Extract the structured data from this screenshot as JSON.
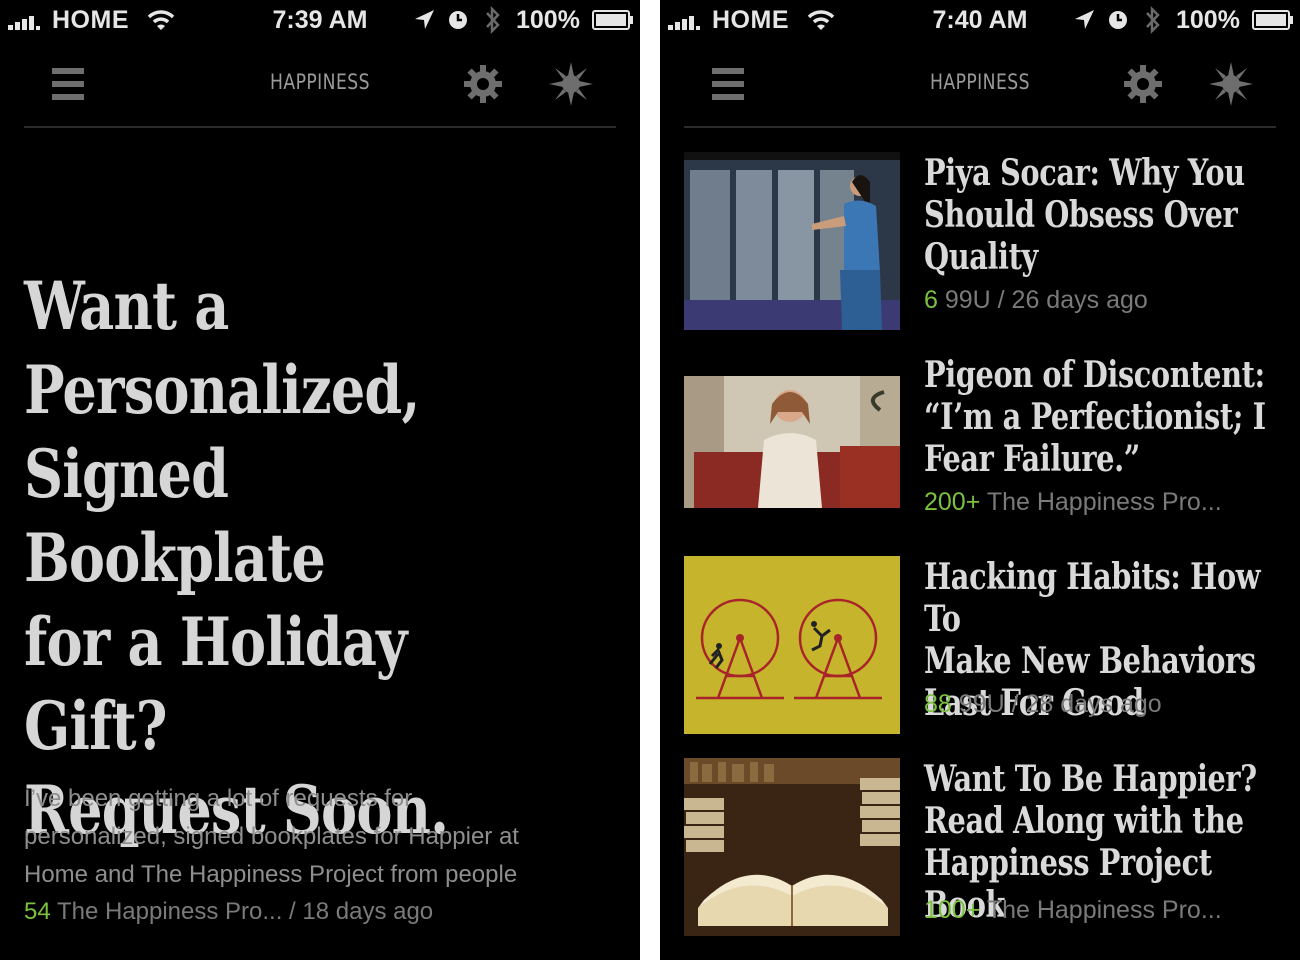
{
  "left": {
    "status": {
      "carrier": "HOME",
      "time": "7:39 AM",
      "battery": "100%"
    },
    "nav": {
      "title": "HAPPINESS"
    },
    "article": {
      "headline_lines": [
        "Want a",
        "Personalized,",
        "Signed Bookplate",
        "for a Holiday Gift?",
        "Request Soon."
      ],
      "excerpt_lines": [
        "I’ve been getting a lot of requests for",
        "personalized, signed bookplates for Happier at",
        "Home and The Happiness Project from people"
      ],
      "count": "54",
      "source": "The Happiness Pro... / 18 days ago"
    }
  },
  "right": {
    "status": {
      "carrier": "HOME",
      "time": "7:40 AM",
      "battery": "100%"
    },
    "nav": {
      "title": "HAPPINESS"
    },
    "items": [
      {
        "title_lines": [
          "Piya Socar: Why You",
          "Should Obsess Over",
          "Quality"
        ],
        "count": "6",
        "source": "99U / 26 days ago",
        "thumb": "speaker-photo"
      },
      {
        "title_lines": [
          "Pigeon of Discontent:",
          "“I’m a Perfectionist; I",
          "Fear Failure.”"
        ],
        "count": "200+",
        "source": "The Happiness Pro...",
        "thumb": "woman-red-chair-photo"
      },
      {
        "title_lines": [
          "Hacking Habits: How To",
          "Make New Behaviors",
          "Last For Good"
        ],
        "count": "88",
        "source": "99U / 28 days ago",
        "thumb": "hamster-wheels-illustration"
      },
      {
        "title_lines": [
          "Want To Be Happier?",
          "Read Along with the",
          "Happiness Project Book"
        ],
        "count": "100+",
        "source": "The Happiness Pro...",
        "thumb": "open-books-photo"
      }
    ]
  },
  "colors": {
    "background": "#000000",
    "accent_count": "#7bc140",
    "meta_text": "#7a7a7a",
    "headline": "#d6d6d6"
  }
}
